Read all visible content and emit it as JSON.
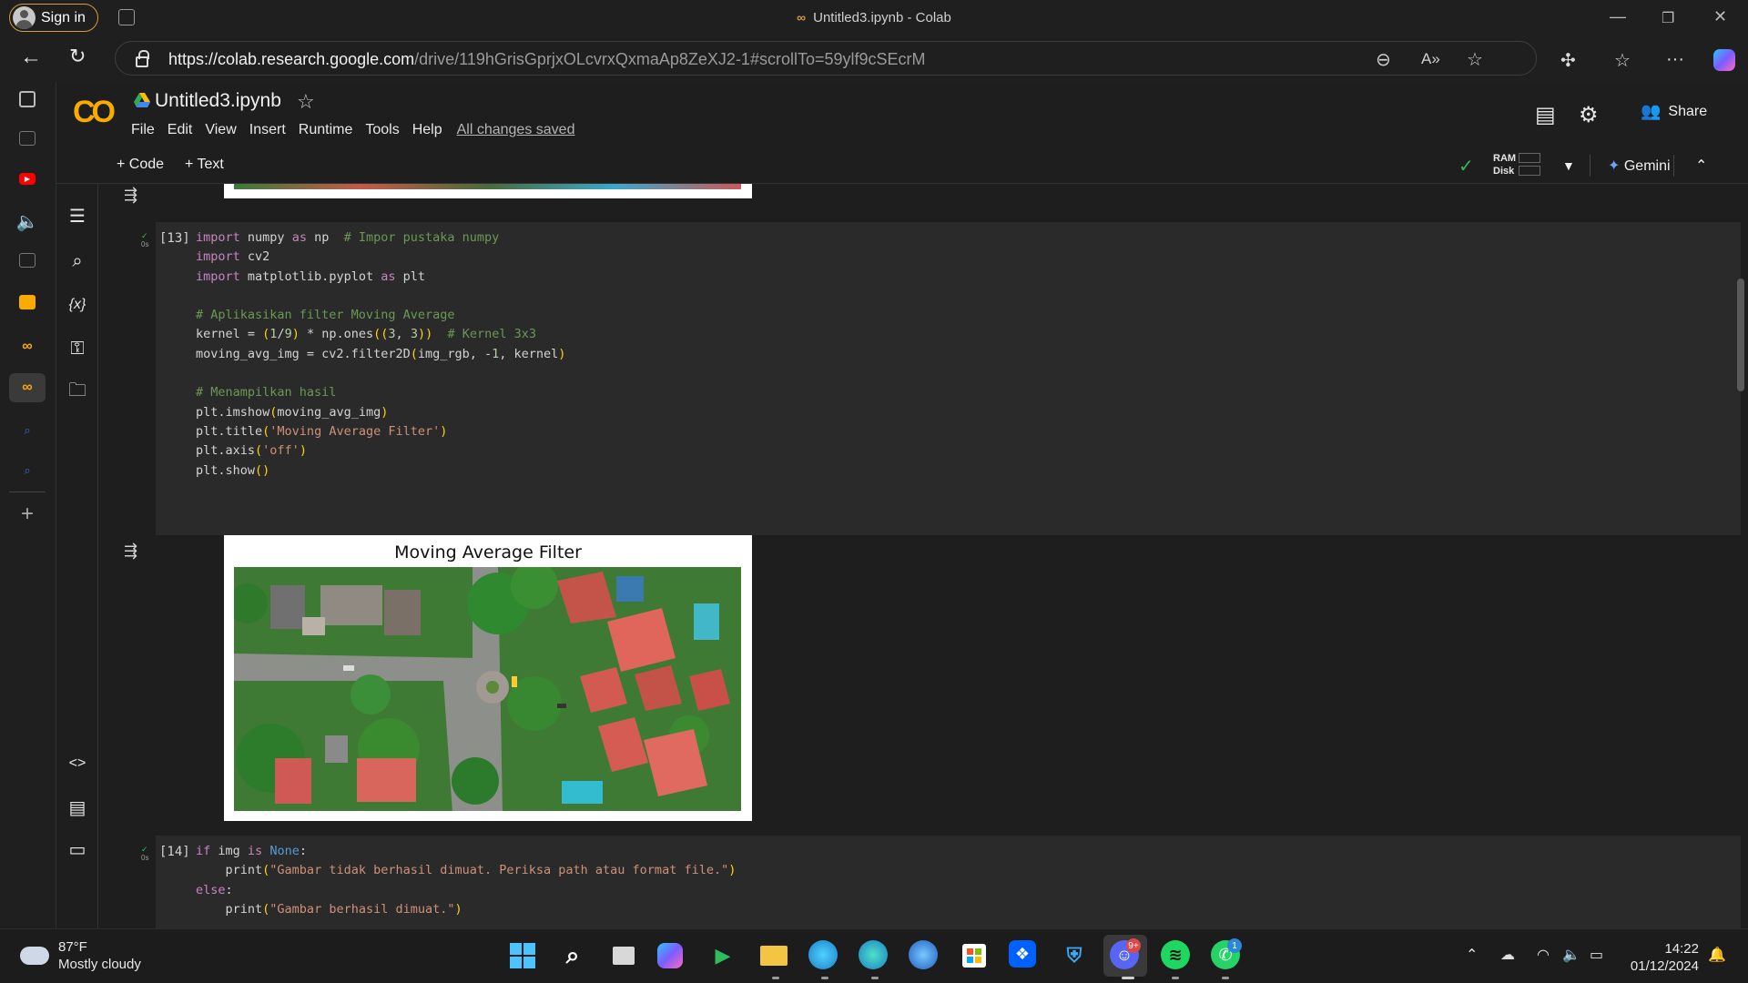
{
  "browser": {
    "sign_in_label": "Sign in",
    "window_title": "Untitled3.ipynb - Colab",
    "url_host": "https://colab.research.google.com",
    "url_path": "/drive/119hGrisGprjxOLcvrxQxmaAp8ZeXJ2-1#scrollTo=59ylf9cSEcrM"
  },
  "colab": {
    "logo": "CO",
    "notebook_title": "Untitled3.ipynb",
    "menu": [
      "File",
      "Edit",
      "View",
      "Insert",
      "Runtime",
      "Tools",
      "Help"
    ],
    "save_status": "All changes saved",
    "share_label": "Share",
    "toolbar": {
      "add_code": "Code",
      "add_text": "Text",
      "ram_label": "RAM",
      "disk_label": "Disk",
      "gemini_label": "Gemini"
    }
  },
  "cells": [
    {
      "exec_count": "[13]",
      "run_time": "0s",
      "lines": [
        "import numpy as np  # Impor pustaka numpy",
        "import cv2",
        "import matplotlib.pyplot as plt",
        "",
        "# Aplikasikan filter Moving Average",
        "kernel = (1/9) * np.ones((3, 3))  # Kernel 3x3",
        "moving_avg_img = cv2.filter2D(img_rgb, -1, kernel)",
        "",
        "# Menampilkan hasil",
        "plt.imshow(moving_avg_img)",
        "plt.title('Moving Average Filter')",
        "plt.axis('off')",
        "plt.show()"
      ],
      "output_title": "Moving Average Filter"
    },
    {
      "exec_count": "[14]",
      "run_time": "0s",
      "lines": [
        "if img is None:",
        "    print(\"Gambar tidak berhasil dimuat. Periksa path atau format file.\")",
        "else:",
        "    print(\"Gambar berhasil dimuat.\")"
      ]
    }
  ],
  "taskbar": {
    "weather_temp": "87°F",
    "weather_desc": "Mostly cloudy",
    "time": "14:22",
    "date": "01/12/2024",
    "discord_badge": "9+",
    "whatsapp_badge": "1"
  },
  "colors": {
    "colab_orange": "#f9ab00",
    "cell_bg": "#2a2a2a",
    "success_green": "#2dbd5a"
  },
  "icons": [
    "sign-in-avatar-icon",
    "back-icon",
    "refresh-icon",
    "lock-icon",
    "zoom-icon",
    "read-aloud-icon",
    "favorite-icon",
    "extensions-icon",
    "collections-icon",
    "more-icon",
    "copilot-icon",
    "comment-icon",
    "settings-icon",
    "share-icon",
    "toc-icon",
    "search-icon",
    "variables-icon",
    "secrets-key-icon",
    "folder-icon",
    "code-snippets-icon",
    "terminal-icon"
  ]
}
